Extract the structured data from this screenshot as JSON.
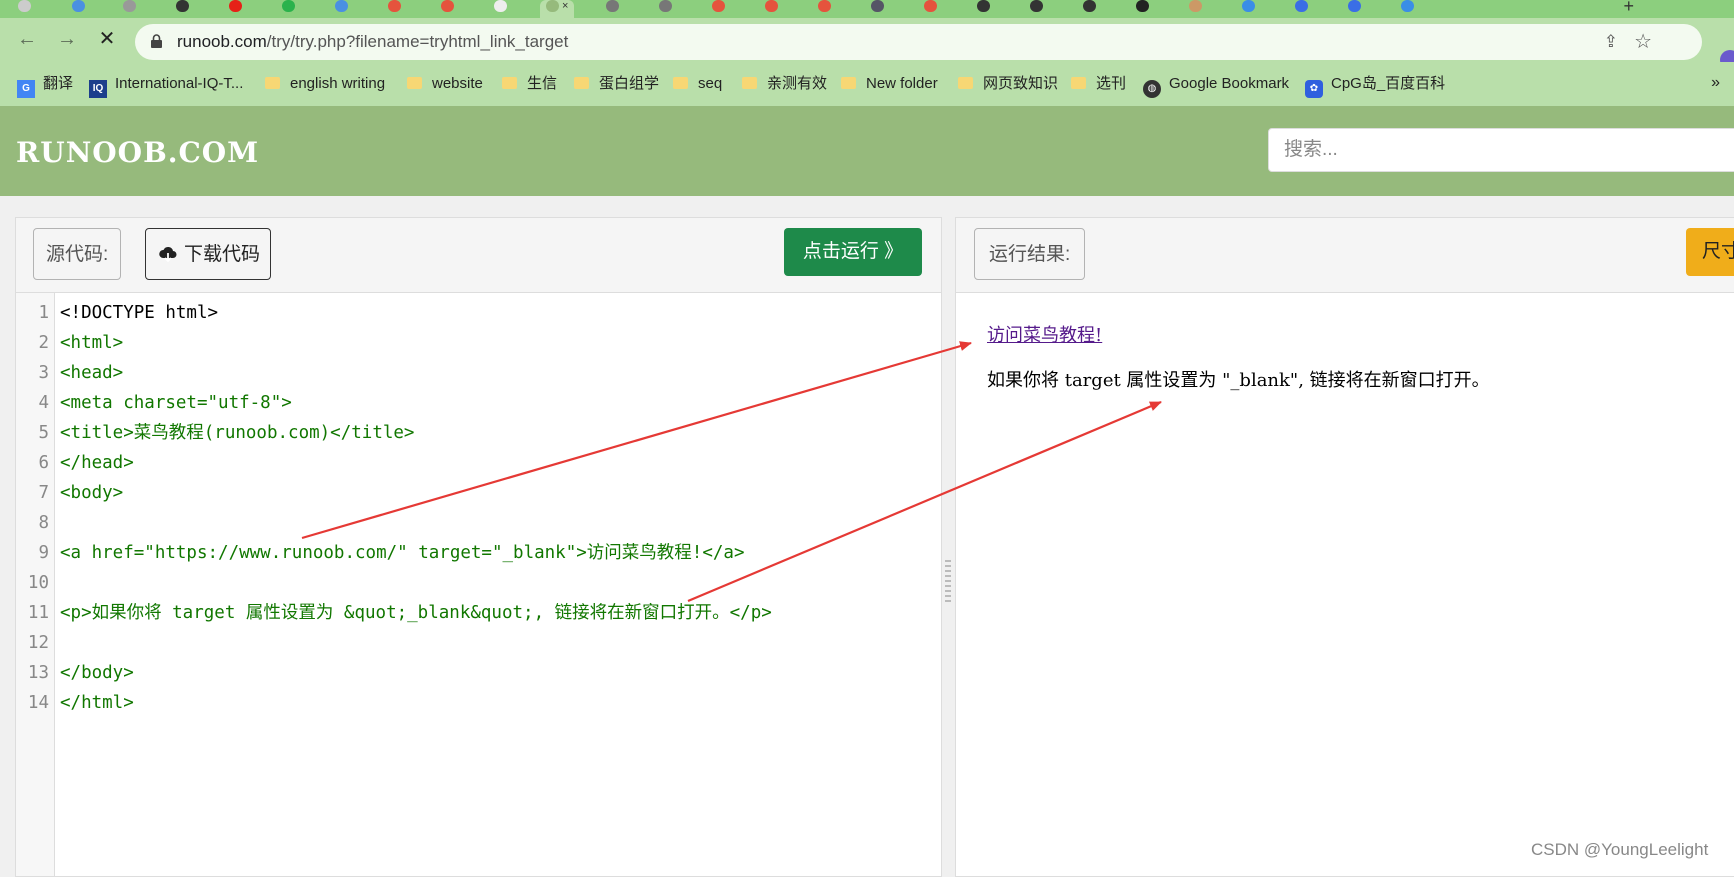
{
  "browser": {
    "active_tab_title": "×",
    "url_host": "runoob.com",
    "url_path": "/try/try.php?filename=tryhtml_link_target",
    "bookmarks": [
      {
        "label": "翻译",
        "icon": "google-translate-icon"
      },
      {
        "label": "International-IQ-T...",
        "icon": "iq-icon"
      },
      {
        "label": "english writing",
        "icon": "folder-icon"
      },
      {
        "label": "website",
        "icon": "folder-icon"
      },
      {
        "label": "生信",
        "icon": "folder-icon"
      },
      {
        "label": "蛋白组学",
        "icon": "folder-icon"
      },
      {
        "label": "seq",
        "icon": "folder-icon"
      },
      {
        "label": "亲测有效",
        "icon": "folder-icon"
      },
      {
        "label": "New folder",
        "icon": "folder-icon"
      },
      {
        "label": "网页致知识",
        "icon": "folder-icon"
      },
      {
        "label": "选刊",
        "icon": "folder-icon"
      },
      {
        "label": "Google Bookmark",
        "icon": "globe-icon"
      },
      {
        "label": "CpG岛_百度百科",
        "icon": "baidu-icon"
      }
    ],
    "bookmarks_more": "»"
  },
  "site": {
    "logo": "RUNOOB.COM",
    "search_placeholder": "搜索..."
  },
  "editor": {
    "source_label": "源代码:",
    "download_label": "下载代码",
    "run_label": "点击运行 》",
    "line_numbers": [
      "1",
      "2",
      "3",
      "4",
      "5",
      "6",
      "7",
      "8",
      "9",
      "10",
      "11",
      "12",
      "13",
      "14"
    ],
    "lines": [
      "<!DOCTYPE html>",
      "<html>",
      "<head>",
      "<meta charset=\"utf-8\">",
      "<title>菜鸟教程(runoob.com)</title>",
      "</head>",
      "<body>",
      "",
      "<a href=\"https://www.runoob.com/\" target=\"_blank\">访问菜鸟教程!</a>",
      "",
      "<p>如果你将 target 属性设置为 &quot;_blank&quot;, 链接将在新窗口打开。</p>",
      "",
      "</body>",
      "</html>"
    ]
  },
  "result": {
    "label": "运行结果:",
    "size_button": "尺寸",
    "link_text": "访问菜鸟教程!",
    "paragraph": "如果你将 target 属性设置为 \"_blank\", 链接将在新窗口打开。"
  },
  "watermark": "CSDN @YoungLeelight",
  "colors": {
    "tabstrip": "#8ccf7e",
    "toolbar": "#b9dfaa",
    "site_header": "#96ba7c",
    "run_button": "#1e8a4a",
    "size_button": "#f0ad1a",
    "annotation_arrow": "#e53935"
  }
}
